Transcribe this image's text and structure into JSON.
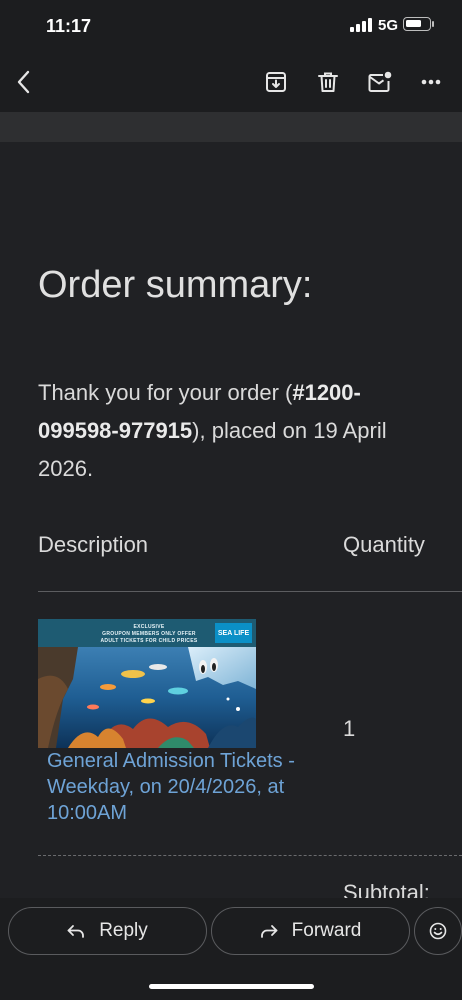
{
  "status": {
    "time": "11:17",
    "network": "5G"
  },
  "toolbar": {
    "icons": [
      "back-arrow-icon",
      "archive-icon",
      "trash-icon",
      "mark-unread-icon",
      "more-icon"
    ]
  },
  "email": {
    "title": "Order summary:",
    "intro_prefix": "Thank you for your order (",
    "order_number": "#1200-099598-977915",
    "intro_suffix": "), placed on 19 April 2026.",
    "table": {
      "col_description": "Description",
      "col_quantity": "Quantity"
    },
    "item": {
      "image_banner_line1": "EXCLUSIVE",
      "image_banner_line2": "GROUPON MEMBERS ONLY OFFER",
      "image_banner_line3": "ADULT TICKETS FOR CHILD PRICES",
      "image_logo": "SEA LIFE",
      "name": "General Admission Tickets - Weekday, on 20/4/2026, at 10:00AM",
      "quantity": "1"
    },
    "subtotal_label": "Subtotal:"
  },
  "actions": {
    "reply": "Reply",
    "forward": "Forward"
  },
  "colors": {
    "background": "#202124",
    "link": "#6ea3d6",
    "bar": "#1c1d1f"
  }
}
